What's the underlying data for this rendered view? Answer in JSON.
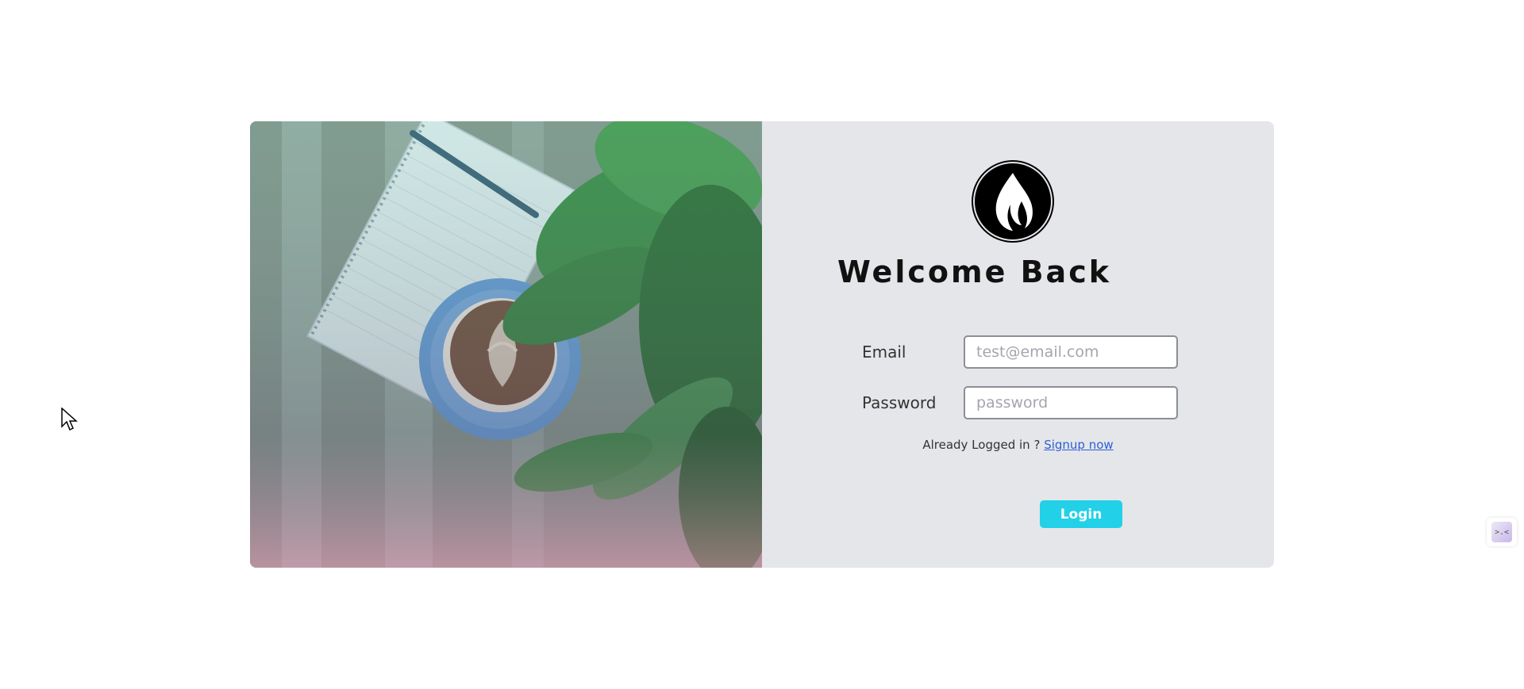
{
  "form": {
    "title": "Welcome Back",
    "email_label": "Email",
    "email_placeholder": "test@email.com",
    "password_label": "Password",
    "password_placeholder": "password",
    "signup_prompt": "Already Logged in ?",
    "signup_link": "Signup now",
    "login_label": "Login"
  },
  "widget": {
    "glyph": ">.<"
  },
  "icons": {
    "logo": "flame-icon",
    "cursor": "mouse-pointer-icon",
    "widget": "assistant-widget-icon"
  },
  "colors": {
    "panel_bg": "#e5e6e9",
    "login_button": "#22d1e8",
    "link": "#2d5fd6"
  }
}
